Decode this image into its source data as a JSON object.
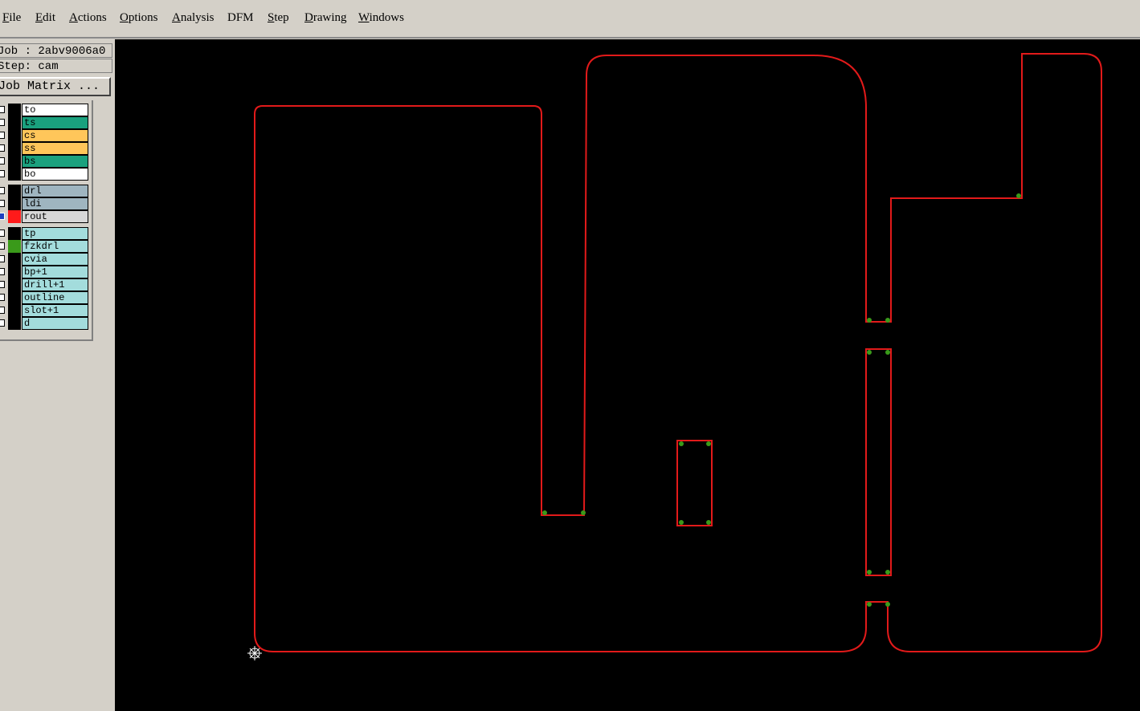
{
  "menu": [
    {
      "label": "File",
      "mnemonic": "F",
      "rest": "ile"
    },
    {
      "label": "Edit",
      "mnemonic": "E",
      "rest": "dit"
    },
    {
      "label": "Actions",
      "mnemonic": "A",
      "rest": "ctions"
    },
    {
      "label": "Options",
      "mnemonic": "O",
      "rest": "ptions"
    },
    {
      "label": "Analysis",
      "mnemonic": "A",
      "rest": "nalysis"
    },
    {
      "label": "DFM",
      "mnemonic": "",
      "rest": "DFM"
    },
    {
      "label": "Step",
      "mnemonic": "S",
      "rest": "tep"
    },
    {
      "label": "Drawing",
      "mnemonic": "D",
      "rest": "rawing"
    },
    {
      "label": "Windows",
      "mnemonic": "W",
      "rest": "indows"
    }
  ],
  "panel": {
    "job_text": "Job : 2abv9006a0",
    "step_text": "Step: cam",
    "job_matrix_label": "Job Matrix ..."
  },
  "layers": [
    {
      "name": "to",
      "color": "#ffffff",
      "marker": "pen-icon",
      "marker_char": "✎"
    },
    {
      "name": "ts",
      "color": "#1aa17e",
      "marker": "pen-icon",
      "marker_char": "✎"
    },
    {
      "name": "cs",
      "color": "#ffc65a",
      "marker": "",
      "marker_char": ""
    },
    {
      "name": "ss",
      "color": "#ffc65a",
      "marker": "",
      "marker_char": ""
    },
    {
      "name": "bs",
      "color": "#1aa17e",
      "marker": "pen-icon",
      "marker_char": "✎"
    },
    {
      "name": "bo",
      "color": "#ffffff",
      "marker": "",
      "marker_char": ""
    },
    {
      "name": "drl",
      "color": "#9fb5c0",
      "marker": "",
      "marker_char": ""
    },
    {
      "name": "ldi",
      "color": "#9fb5c0",
      "marker": "",
      "marker_char": ""
    },
    {
      "name": "rout",
      "color": "#d7d7d7",
      "marker": "grid-icon",
      "marker_char": "⊞",
      "active": true
    },
    {
      "name": "tp",
      "color": "#a3dcdc",
      "marker": "",
      "marker_char": ""
    },
    {
      "name": "fzkdrl",
      "color": "#a3dcdc",
      "marker": "",
      "marker_char": "",
      "swatch": "#3a9a1a"
    },
    {
      "name": "cvia",
      "color": "#a3dcdc",
      "marker": "",
      "marker_char": ""
    },
    {
      "name": "bp+1",
      "color": "#a3dcdc",
      "marker": "",
      "marker_char": ""
    },
    {
      "name": "drill+1",
      "color": "#a3dcdc",
      "marker": "",
      "marker_char": ""
    },
    {
      "name": "outline",
      "color": "#a3dcdc",
      "marker": "",
      "marker_char": ""
    },
    {
      "name": "slot+1",
      "color": "#a3dcdc",
      "marker": "",
      "marker_char": ""
    },
    {
      "name": "d",
      "color": "#a3dcdc",
      "marker": "",
      "marker_char": ""
    }
  ],
  "colors": {
    "rout_line": "#e21a1a",
    "drill_points": "#3a9a1a",
    "canvas_bg": "#000000",
    "active_layer_checkbox": "#1f3fbf",
    "active_layer_swatch": "#ff1a1a",
    "origin_marker": "#ffffff"
  },
  "canvas": {
    "origin_icon": "origin-crosshair-icon"
  }
}
